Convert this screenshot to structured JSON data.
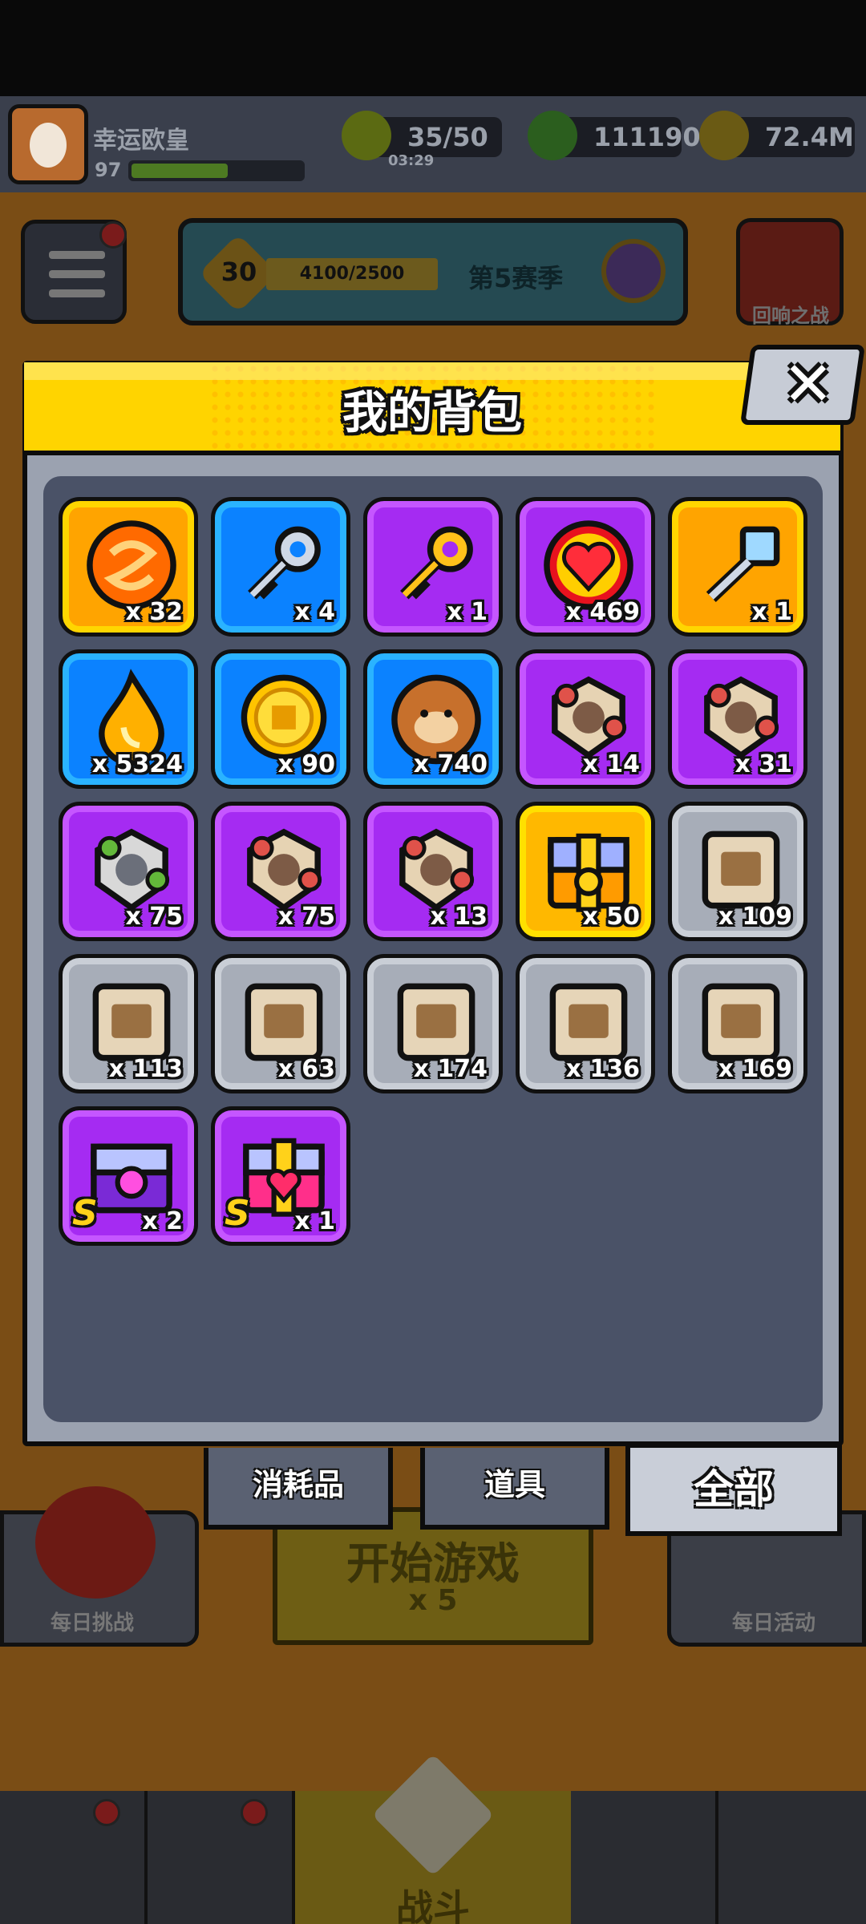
{
  "player": {
    "name": "幸运欧皇",
    "level": "97"
  },
  "resources": {
    "energy": "35/50",
    "energy_timer": "03:29",
    "gems": "111190",
    "gold": "72.4M"
  },
  "season": {
    "level": "30",
    "progress": "4100/2500",
    "name": "第5赛季"
  },
  "side_buttons": {
    "echo_battle": "回响之战",
    "daily_challenge": "每日挑战",
    "daily_event": "每日活动"
  },
  "start_game": {
    "title": "开始游戏",
    "cost": "x 5"
  },
  "bottom_nav": {
    "battle": "战斗"
  },
  "colors": {
    "header_yellow": "#ffd400",
    "panel": "#4a5267",
    "tile_purple": "#a52bf2",
    "tile_blue": "#0b82ff",
    "tile_orange": "#ffa400",
    "tile_grey": "#a7adb8"
  },
  "backpack": {
    "title": "我的背包",
    "close": "✕",
    "items": [
      {
        "name": "orange-swirl-orb",
        "qty": "x 32",
        "rarity": "orange"
      },
      {
        "name": "silver-key",
        "qty": "x 4",
        "rarity": "blue"
      },
      {
        "name": "gold-key",
        "qty": "x 1",
        "rarity": "purple"
      },
      {
        "name": "heart-orb",
        "qty": "x 469",
        "rarity": "purple"
      },
      {
        "name": "crystal-key",
        "qty": "x 1",
        "rarity": "orange"
      },
      {
        "name": "flame-drop",
        "qty": "x 5324",
        "rarity": "blue"
      },
      {
        "name": "gold-coin",
        "qty": "x 90",
        "rarity": "blue"
      },
      {
        "name": "dog-cookie",
        "qty": "x 740",
        "rarity": "blue"
      },
      {
        "name": "puzzle-piece-goggles",
        "qty": "x 14",
        "rarity": "purple"
      },
      {
        "name": "puzzle-piece-hero",
        "qty": "x 31",
        "rarity": "purple"
      },
      {
        "name": "puzzle-piece-cat",
        "qty": "x 75",
        "rarity": "purple"
      },
      {
        "name": "puzzle-piece-mask",
        "qty": "x 75",
        "rarity": "purple"
      },
      {
        "name": "puzzle-piece-girl",
        "qty": "x 13",
        "rarity": "purple"
      },
      {
        "name": "gold-chest",
        "qty": "x 50",
        "rarity": "gold"
      },
      {
        "name": "blueprint-gun",
        "qty": "x 109",
        "rarity": "grey"
      },
      {
        "name": "blueprint-shirt",
        "qty": "x 113",
        "rarity": "grey"
      },
      {
        "name": "blueprint-necklace",
        "qty": "x 63",
        "rarity": "grey"
      },
      {
        "name": "blueprint-belt",
        "qty": "x 174",
        "rarity": "grey"
      },
      {
        "name": "blueprint-glove",
        "qty": "x 136",
        "rarity": "grey"
      },
      {
        "name": "blueprint-boots",
        "qty": "x 169",
        "rarity": "grey"
      },
      {
        "name": "s-chest-purple",
        "qty": "x 2",
        "rarity": "purple",
        "rank": "S"
      },
      {
        "name": "s-chest-heart",
        "qty": "x 1",
        "rarity": "purple",
        "rank": "S"
      }
    ],
    "tabs": [
      {
        "label": "消耗品",
        "active": false
      },
      {
        "label": "道具",
        "active": false
      },
      {
        "label": "全部",
        "active": true
      }
    ]
  }
}
